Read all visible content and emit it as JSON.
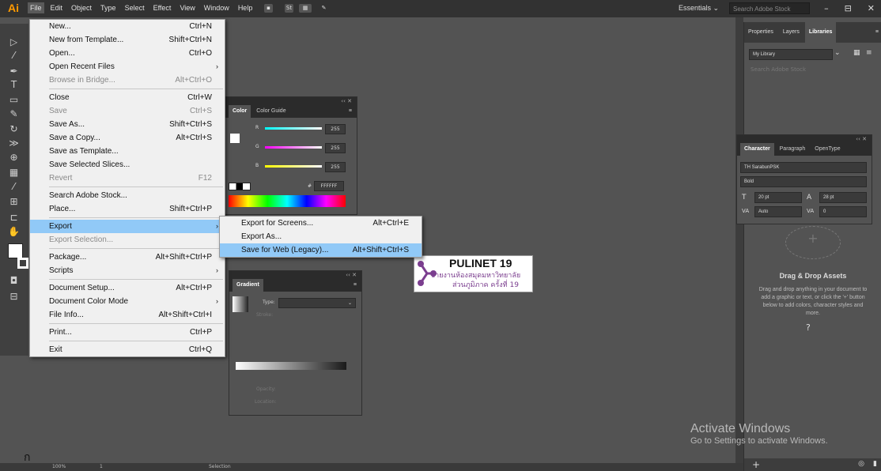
{
  "app": {
    "logo": "Ai"
  },
  "menubar": {
    "items": [
      "File",
      "Edit",
      "Object",
      "Type",
      "Select",
      "Effect",
      "View",
      "Window",
      "Help"
    ],
    "st_label": "St",
    "workspace": "Essentials ⌄",
    "stock_search_placeholder": "Search Adobe Stock",
    "window_buttons": [
      "–",
      "⊟",
      "✕"
    ]
  },
  "file_menu": {
    "items": [
      {
        "label": "New...",
        "shortcut": "Ctrl+N",
        "disabled": false
      },
      {
        "label": "New from Template...",
        "shortcut": "Shift+Ctrl+N",
        "disabled": false
      },
      {
        "label": "Open...",
        "shortcut": "Ctrl+O",
        "disabled": false
      },
      {
        "label": "Open Recent Files",
        "shortcut": "",
        "submenu": true,
        "disabled": false
      },
      {
        "label": "Browse in Bridge...",
        "shortcut": "Alt+Ctrl+O",
        "disabled": true
      },
      {
        "sep": true
      },
      {
        "label": "Close",
        "shortcut": "Ctrl+W",
        "disabled": false
      },
      {
        "label": "Save",
        "shortcut": "Ctrl+S",
        "disabled": true
      },
      {
        "label": "Save As...",
        "shortcut": "Shift+Ctrl+S",
        "disabled": false
      },
      {
        "label": "Save a Copy...",
        "shortcut": "Alt+Ctrl+S",
        "disabled": false
      },
      {
        "label": "Save as Template...",
        "shortcut": "",
        "disabled": false
      },
      {
        "label": "Save Selected Slices...",
        "shortcut": "",
        "disabled": false
      },
      {
        "label": "Revert",
        "shortcut": "F12",
        "disabled": true
      },
      {
        "sep": true
      },
      {
        "label": "Search Adobe Stock...",
        "shortcut": "",
        "disabled": false
      },
      {
        "label": "Place...",
        "shortcut": "Shift+Ctrl+P",
        "disabled": false
      },
      {
        "sep": true
      },
      {
        "label": "Export",
        "shortcut": "",
        "submenu": true,
        "highlighted": true,
        "disabled": false
      },
      {
        "label": "Export Selection...",
        "shortcut": "",
        "disabled": true
      },
      {
        "sep": true
      },
      {
        "label": "Package...",
        "shortcut": "Alt+Shift+Ctrl+P",
        "disabled": false
      },
      {
        "label": "Scripts",
        "shortcut": "",
        "submenu": true,
        "disabled": false
      },
      {
        "sep": true
      },
      {
        "label": "Document Setup...",
        "shortcut": "Alt+Ctrl+P",
        "disabled": false
      },
      {
        "label": "Document Color Mode",
        "shortcut": "",
        "submenu": true,
        "disabled": false
      },
      {
        "label": "File Info...",
        "shortcut": "Alt+Shift+Ctrl+I",
        "disabled": false
      },
      {
        "sep": true
      },
      {
        "label": "Print...",
        "shortcut": "Ctrl+P",
        "disabled": false
      },
      {
        "sep": true
      },
      {
        "label": "Exit",
        "shortcut": "Ctrl+Q",
        "disabled": false
      }
    ]
  },
  "export_submenu": {
    "items": [
      {
        "label": "Export for Screens...",
        "shortcut": "Alt+Ctrl+E",
        "highlighted": false
      },
      {
        "label": "Export As...",
        "shortcut": "",
        "highlighted": false
      },
      {
        "label": "Save for Web (Legacy)...",
        "shortcut": "Alt+Shift+Ctrl+S",
        "highlighted": true
      }
    ]
  },
  "color_panel": {
    "tabs": [
      "Color",
      "Color Guide"
    ],
    "r_label": "R",
    "g_label": "G",
    "b_label": "B",
    "r": "255",
    "g": "255",
    "b": "255",
    "hex_prefix": "#",
    "hex": "FFFFFF"
  },
  "gradient_panel": {
    "tab": "Gradient",
    "type_label": "Type:",
    "stroke_label": "Stroke:",
    "opacity_label": "Opacity:",
    "location_label": "Location:"
  },
  "libraries_panel": {
    "tabs": [
      "Properties",
      "Layers",
      "Libraries"
    ],
    "library": "My Library",
    "search_placeholder": "Search Adobe Stock",
    "drag_title": "Drag & Drop Assets",
    "drag_desc": "Drag and drop anything in your document to add a graphic or text, or click the '+' button below to add colors, character styles and more."
  },
  "character_panel": {
    "tabs": [
      "Character",
      "Paragraph",
      "OpenType"
    ],
    "font": "TH SarabunPSK",
    "style": "Bold",
    "size": "20 pt",
    "leading": "28 pt",
    "kerning": "Auto",
    "tracking": "0"
  },
  "artwork": {
    "title": "PULINET 19",
    "line1": "ข่ายงานห้องสมุดมหาวิทยาลัย",
    "line2": "ส่วนภูมิภาค ครั้งที่ 19"
  },
  "statusbar": {
    "zoom": "100%",
    "artboard": "1",
    "tool": "Selection"
  },
  "watermark": {
    "title": "Activate Windows",
    "subtitle": "Go to Settings to activate Windows."
  },
  "stray_glyph": "ก"
}
